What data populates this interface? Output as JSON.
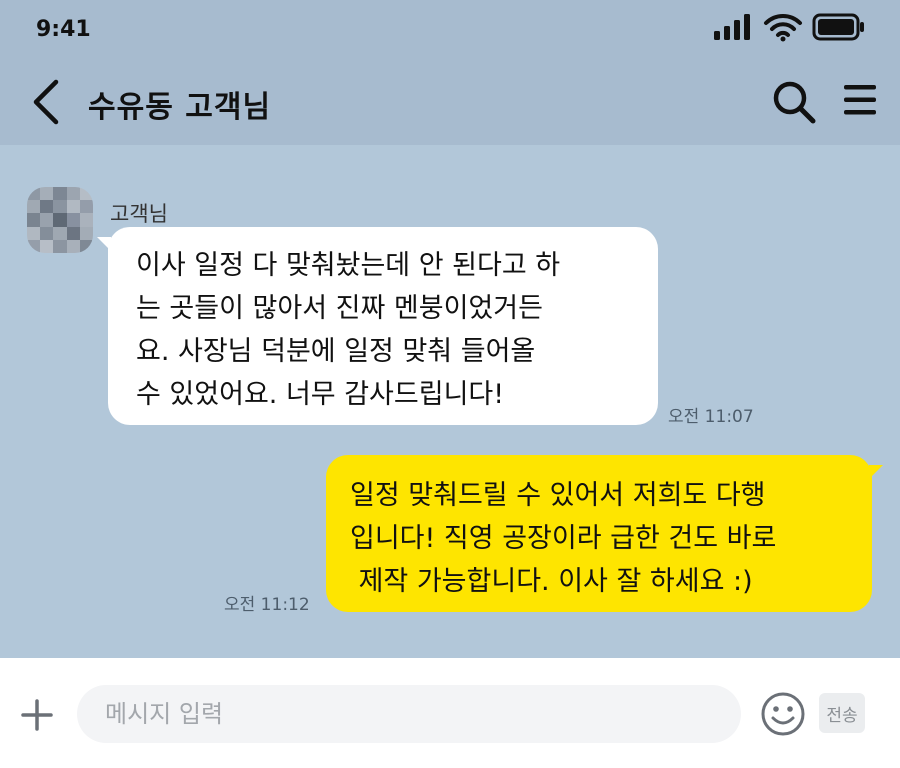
{
  "status_bar": {
    "time": "9:41"
  },
  "header": {
    "title": "수유동 고객님"
  },
  "messages": [
    {
      "direction": "incoming",
      "sender": "고객님",
      "lines": [
        "이사 일정 다 맞춰놨는데 안 된다고 하",
        "는 곳들이 많아서 진짜 멘붕이었거든",
        "요. 사장님 덕분에 일정 맞춰 들어올",
        "수 있었어요. 너무 감사드립니다!"
      ],
      "time": "오전 11:07"
    },
    {
      "direction": "outgoing",
      "lines": [
        "일정 맞춰드릴 수 있어서 저희도 다행",
        "입니다! 직영 공장이라 급한 건도 바로",
        " 제작 가능합니다. 이사 잘 하세요 :)"
      ],
      "time": "오전 11:12"
    }
  ],
  "input_bar": {
    "placeholder": "메시지 입력",
    "value": "",
    "send_label": "전송"
  },
  "colors": {
    "chat_background": "#b2c7d9",
    "header_background": "#a7bbcf",
    "incoming_bubble": "#ffffff",
    "outgoing_bubble": "#fee500"
  },
  "icons": [
    "signal-icon",
    "wifi-icon",
    "battery-icon",
    "back-icon",
    "search-icon",
    "menu-icon",
    "plus-icon",
    "emoji-icon"
  ]
}
